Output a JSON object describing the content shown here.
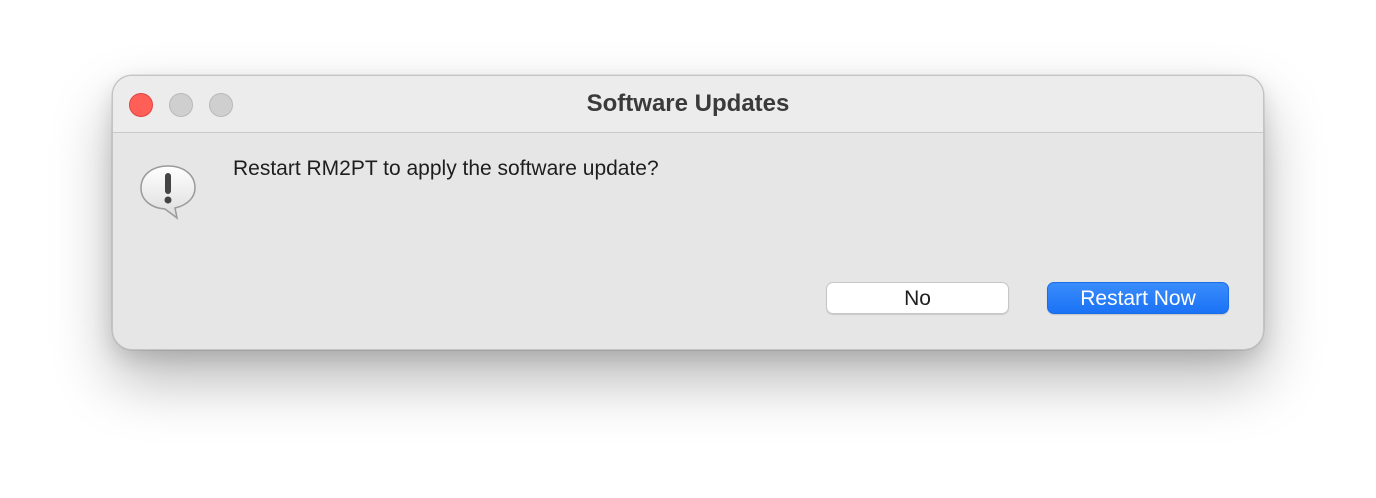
{
  "window": {
    "title": "Software Updates"
  },
  "traffic_lights": {
    "close": "close-button",
    "minimize": "minimize-button",
    "zoom": "zoom-button"
  },
  "alert": {
    "icon": "alert-caution-icon",
    "message": "Restart RM2PT to apply the software update?"
  },
  "buttons": {
    "no_label": "No",
    "primary_label": "Restart Now"
  },
  "colors": {
    "accent": "#1a72f5",
    "close": "#ff5f57",
    "inactive_light": "#cfcfcf"
  }
}
